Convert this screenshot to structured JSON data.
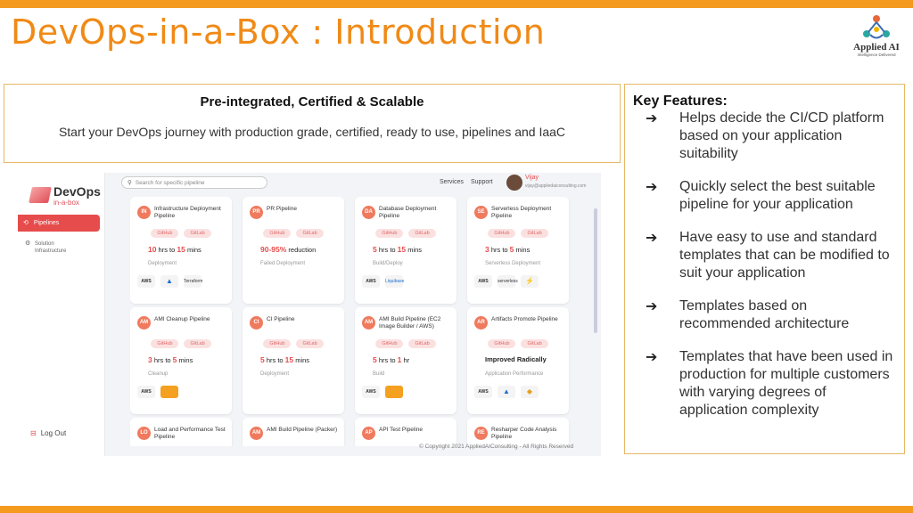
{
  "slide": {
    "title": "DevOps-in-a-Box : Introduction",
    "logo_name": "Applied AI",
    "logo_tagline": "Intelligence Delivered"
  },
  "intro": {
    "heading": "Pre-integrated, Certified & Scalable",
    "subtext": "Start your DevOps journey with production grade, certified, ready to use, pipelines and IaaC"
  },
  "features": {
    "title": "Key Features:",
    "arrow": "➔",
    "items": [
      "Helps decide the CI/CD platform based on your application suitability",
      "Quickly select the best suitable pipeline for your application",
      "Have easy to use and standard templates that can be modified to suit your application",
      "Templates based on recommended architecture",
      "Templates that have been used in production for multiple customers with varying degrees of application complexity"
    ]
  },
  "app": {
    "brand": {
      "name": "DevOps",
      "sub": "in-a-box"
    },
    "nav": [
      {
        "icon": "⟲",
        "label": "Pipelines"
      },
      {
        "icon": "⚙",
        "label": "Solution Infrastructure"
      }
    ],
    "logout_label": "Log Out",
    "search_placeholder": "Search for specific pipeline",
    "services_label": "Services",
    "support_label": "Support",
    "user_name": "Vijay",
    "user_email": "vijay@appliedaiconsulting.com",
    "copyright": "© Copyright 2021 AppliedAIConsulting - All Rights Reserved",
    "chip_github": "GitHub",
    "chip_gitlab": "GitLab",
    "cards": [
      {
        "badge": "IN",
        "title": "Infrastructure Deployment Pipeline",
        "time_a": "10",
        "time_mid": " hrs to ",
        "time_b": "15",
        "time_unit": " mins",
        "category": "Deployment",
        "logos": [
          "AWS",
          "▲",
          "Terraform"
        ]
      },
      {
        "badge": "PR",
        "title": "PR Pipeline",
        "time_a": "90-95%",
        "time_mid": " reduction",
        "time_b": "",
        "time_unit": "",
        "category": "Failed Deployment",
        "logos": []
      },
      {
        "badge": "DA",
        "title": "Database Deployment Pipeline",
        "time_a": "5",
        "time_mid": " hrs to ",
        "time_b": "15",
        "time_unit": " mins",
        "category": "Build/Deploy",
        "logos": [
          "AWS",
          "Liquibase"
        ]
      },
      {
        "badge": "SE",
        "title": "Serverless Deployment Pipeline",
        "time_a": "3",
        "time_mid": " hrs to ",
        "time_b": "5",
        "time_unit": " mins",
        "category": "Serverless Deployment",
        "logos": [
          "AWS",
          "serverless",
          "⚡"
        ]
      },
      {
        "badge": "AM",
        "title": "AMI Cleanup Pipeline",
        "time_a": "3",
        "time_mid": " hrs to ",
        "time_b": "5",
        "time_unit": " mins",
        "category": "Cleanup",
        "logos": [
          "AWS",
          ""
        ]
      },
      {
        "badge": "CI",
        "title": "CI Pipeline",
        "time_a": "5",
        "time_mid": " hrs to ",
        "time_b": "15",
        "time_unit": " mins",
        "category": "Deployment",
        "logos": []
      },
      {
        "badge": "AM",
        "title": "AMI Build Pipeline (EC2 Image Builder / AWS)",
        "time_a": "5",
        "time_mid": " hrs to ",
        "time_b": "1",
        "time_unit": " hr",
        "category": "Build",
        "logos": [
          "AWS",
          ""
        ]
      },
      {
        "badge": "AR",
        "title": "Artifacts Promote Pipeline",
        "time_a": "",
        "time_mid": "Improved Radically",
        "time_b": "",
        "time_unit": "",
        "category": "Application Performance",
        "logos": [
          "AWS",
          "▲",
          "◆"
        ]
      },
      {
        "badge": "LO",
        "title": "Load and Performance Test Pipeline"
      },
      {
        "badge": "AM",
        "title": "AMI Build Pipeline (Packer)"
      },
      {
        "badge": "AP",
        "title": "API Test Pipeline"
      },
      {
        "badge": "RE",
        "title": "Resharper Code Analysis Pipeline"
      }
    ]
  },
  "colors": {
    "accent": "#f39a1f",
    "title": "#f08a16",
    "app_red": "#e74c4c"
  }
}
